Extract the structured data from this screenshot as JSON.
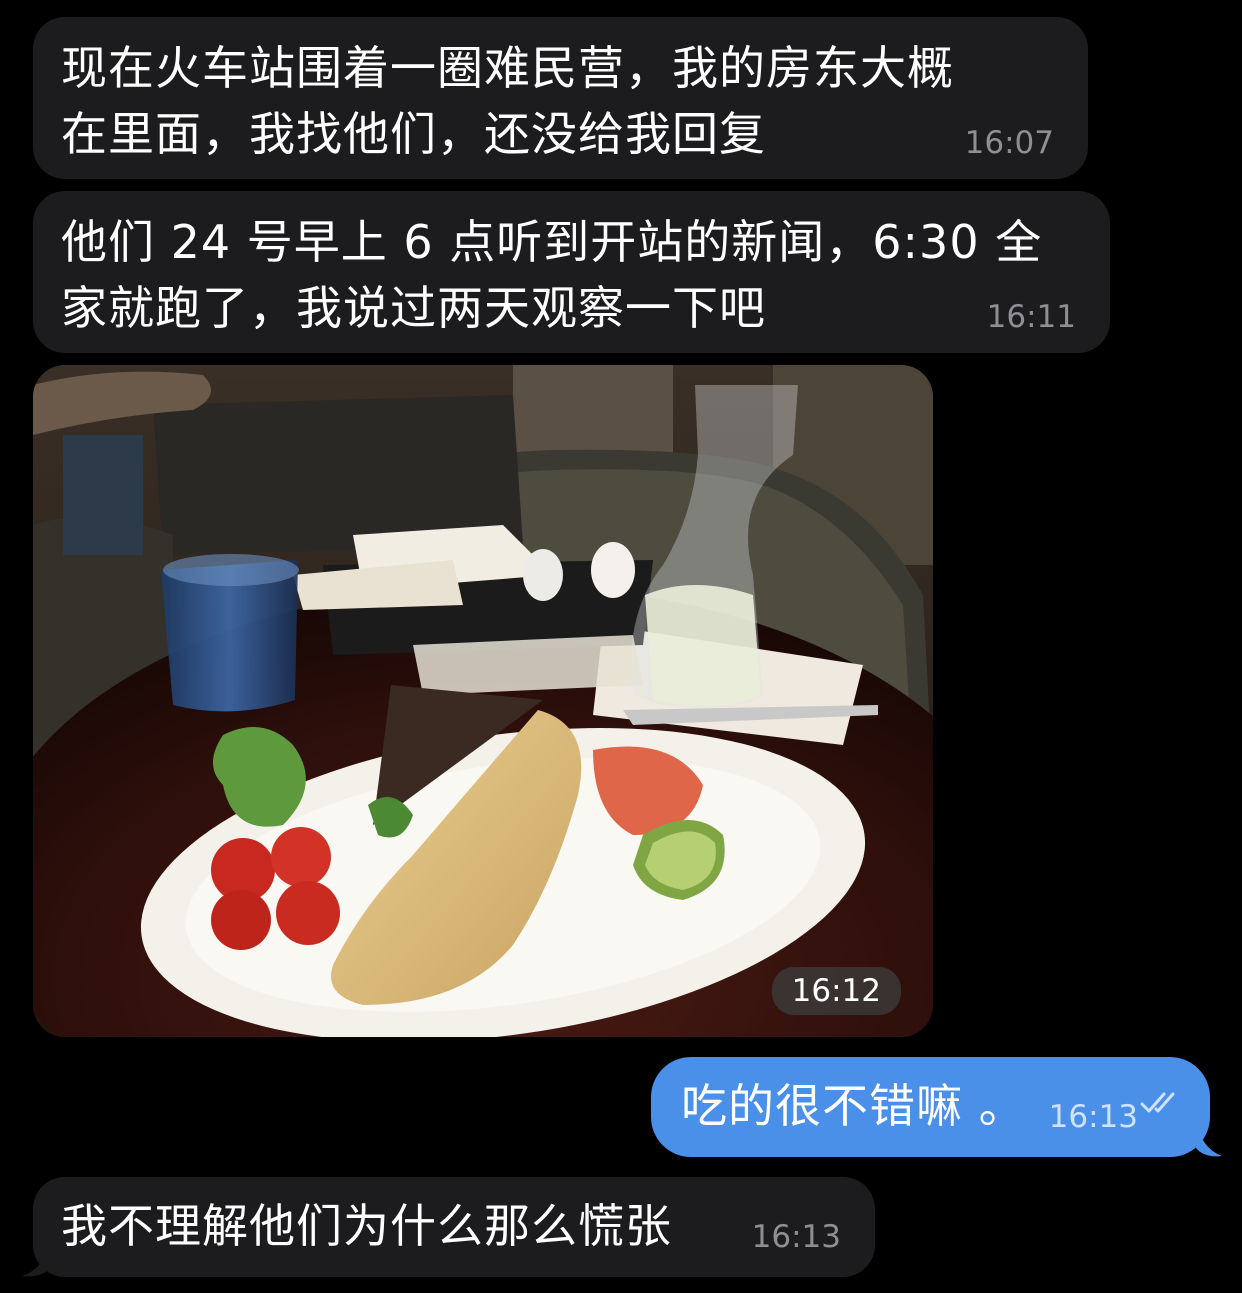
{
  "conversation": {
    "messages": [
      {
        "id": "msg1",
        "direction": "incoming",
        "text": "现在火车站围着一圈难民营，我的房东大概\n在里面，我找他们，还没给我回复",
        "time": "16:07"
      },
      {
        "id": "msg2",
        "direction": "incoming",
        "text": "他们 24 号早上 6 点听到开站的新闻，6:30 全\n家就跑了，我说过两天观察一下吧",
        "time": "16:11"
      },
      {
        "id": "photo",
        "direction": "incoming",
        "type": "photo",
        "time": "16:12"
      },
      {
        "id": "msg3",
        "direction": "outgoing",
        "text": "吃的很不错嘛 。",
        "time": "16:13",
        "status": "read"
      },
      {
        "id": "msg4",
        "direction": "incoming",
        "text": "我不理解他们为什么那么慌张",
        "time": "16:13"
      }
    ]
  },
  "icons": {
    "read_receipt": "double-check-icon"
  },
  "colors": {
    "background": "#000000",
    "incoming_bubble": "#1c1c1e",
    "outgoing_bubble": "#4a90e8",
    "incoming_time": "#8e8e93",
    "outgoing_time": "#cfe2ff"
  }
}
